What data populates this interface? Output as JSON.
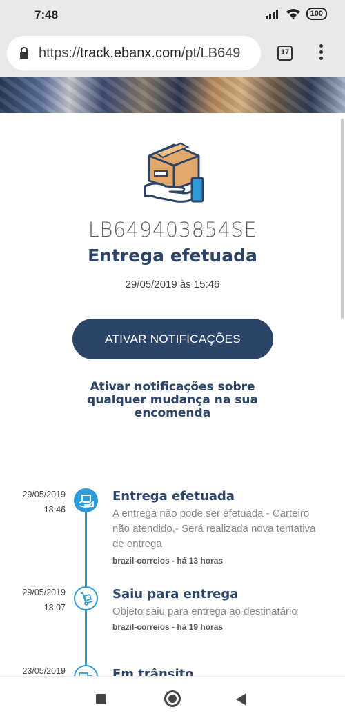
{
  "status_bar": {
    "time": "7:48",
    "battery": "100"
  },
  "browser": {
    "url_scheme": "https://",
    "url_host": "track.ebanx.com",
    "url_path": "/pt/LB649",
    "tab_count": "17"
  },
  "shipment": {
    "tracking_code": "LB649403854SE",
    "status": "Entrega efetuada",
    "datetime": "29/05/2019 às 15:46"
  },
  "notify": {
    "button_label": "ATIVAR NOTIFICAÇÕES",
    "description": "Ativar notificações sobre qualquer mudança na sua encomenda"
  },
  "timeline": [
    {
      "date": "29/05/2019",
      "time": "18:46",
      "title": "Entrega efetuada",
      "description": "A entrega não pode ser efetuada - Carteiro não atendido,- Será realizada nova tentativa de entrega",
      "source": "brazil-correios - há 13 horas",
      "icon": "delivery-box-icon"
    },
    {
      "date": "29/05/2019",
      "time": "13:07",
      "title": "Saiu para entrega",
      "description": "Objeto saiu para entrega ao destinatário",
      "source": "brazil-correios - há 19 horas",
      "icon": "hand-truck-icon"
    },
    {
      "date": "23/05/2019",
      "time": "",
      "title": "Em trânsito",
      "description": "",
      "source": "",
      "icon": "truck-icon"
    }
  ],
  "colors": {
    "brand": "#2d4469",
    "accent": "#2f9ad6"
  }
}
